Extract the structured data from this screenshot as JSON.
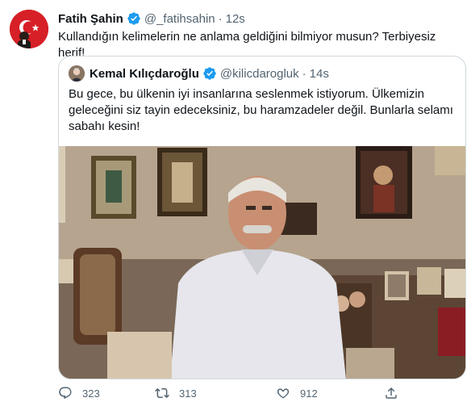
{
  "tweet": {
    "author_name": "Fatih Şahin",
    "handle": "@_fatihsahin",
    "separator": "·",
    "time": "12s",
    "text": "Kullandığın kelimelerin ne anlama geldiğini bilmiyor musun? Terbiyesiz herif!"
  },
  "quoted": {
    "author_name": "Kemal Kılıçdaroğlu",
    "handle": "@kilicdarogluk",
    "separator": "·",
    "time": "14s",
    "text": "Bu gece, bu ülkenin iyi insanlarına seslenmek istiyorum. Ülkemizin geleceğini siz tayin edeceksiniz, bu haramzadeler değil. Bunlarla selamı sabahı kesin!"
  },
  "actions": {
    "reply_count": "323",
    "retweet_count": "313",
    "like_count": "912"
  },
  "icons": {
    "verified": "verified-badge-icon",
    "reply": "reply-icon",
    "retweet": "retweet-icon",
    "like": "heart-icon",
    "share": "share-icon"
  },
  "colors": {
    "verified": "#1d9bf0",
    "text": "#0f1419",
    "secondary": "#536471",
    "border": "#cfd9de",
    "avatar_flag": "#d61f26"
  }
}
